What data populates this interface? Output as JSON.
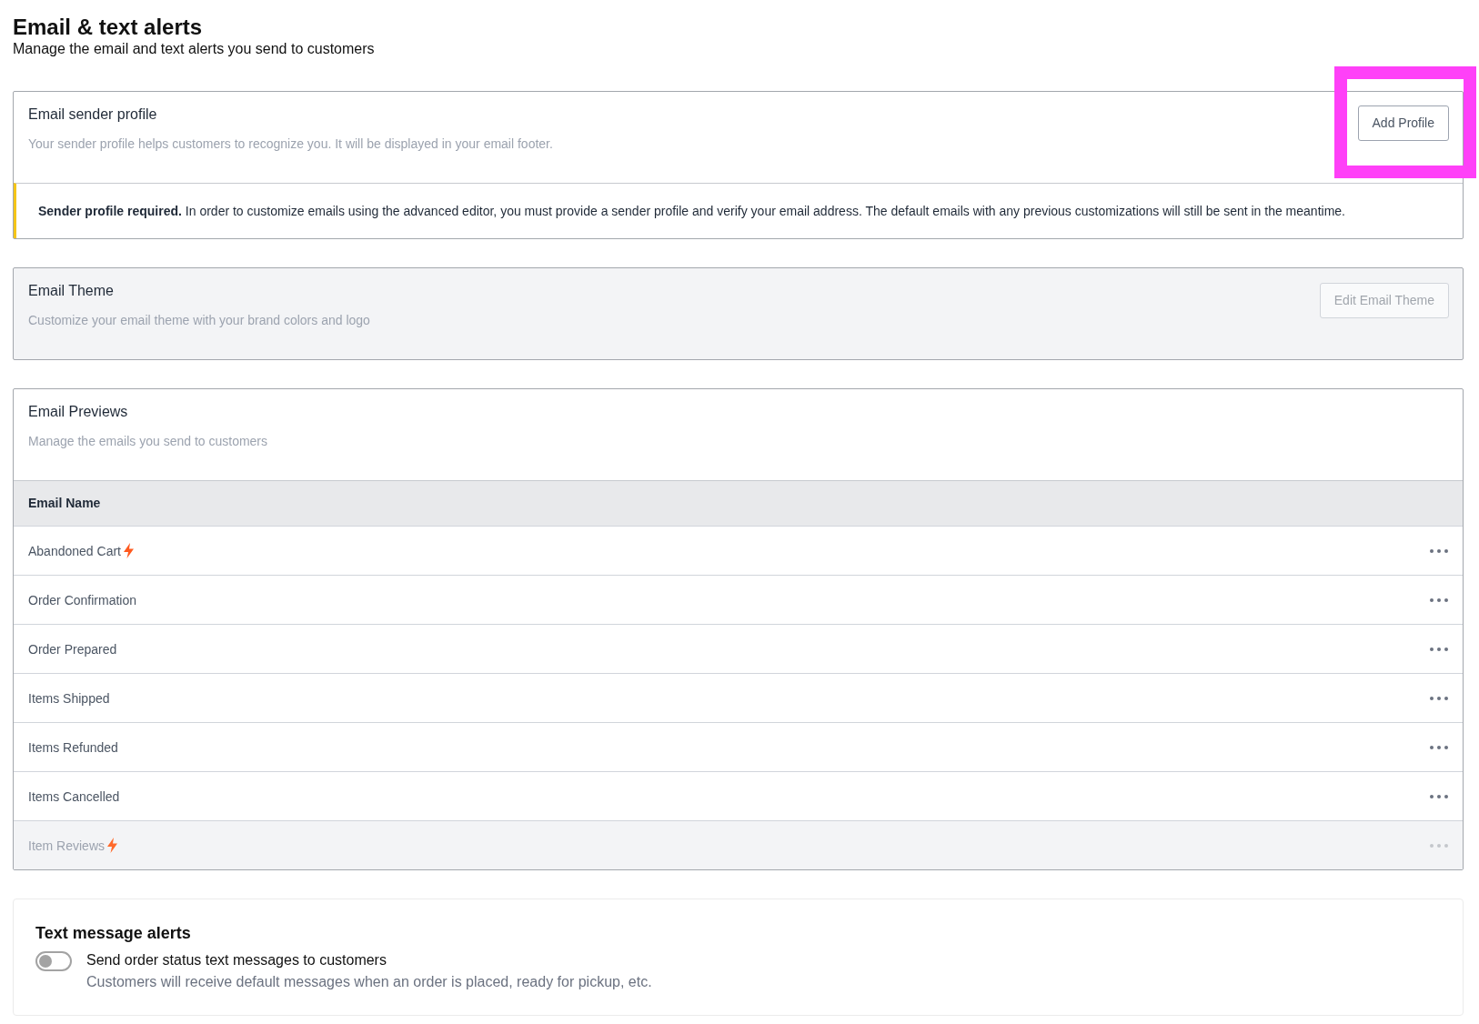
{
  "page": {
    "title": "Email & text alerts",
    "subtitle": "Manage the email and text alerts you send to customers"
  },
  "sender_profile": {
    "title": "Email sender profile",
    "description": "Your sender profile helps customers to recognize you. It will be displayed in your email footer.",
    "button": {
      "label": "Add Profile",
      "highlighted": true
    },
    "alert": {
      "text": "**Sender profile required.** In order to customize emails using the advanced editor, you must provide a sender profile and verify your email address. The default emails with any previous customizations will still be sent in the meantime."
    }
  },
  "email_theme": {
    "title": "Email Theme",
    "description": "Customize your email theme with your brand colors and logo",
    "disabled": true,
    "button": {
      "label": "Edit Email Theme"
    }
  },
  "email_previews": {
    "title": "Email Previews",
    "description": "Manage the emails you send to customers",
    "table": {
      "columns": [
        "Email Name"
      ],
      "rows": [
        {
          "name": "Abandoned Cart",
          "lightning": true,
          "disabled": false
        },
        {
          "name": "Order Confirmation",
          "lightning": false,
          "disabled": false
        },
        {
          "name": "Order Prepared",
          "lightning": false,
          "disabled": false
        },
        {
          "name": "Items Shipped",
          "lightning": false,
          "disabled": false
        },
        {
          "name": "Items Refunded",
          "lightning": false,
          "disabled": false
        },
        {
          "name": "Items Cancelled",
          "lightning": false,
          "disabled": false
        },
        {
          "name": "Item Reviews",
          "lightning": true,
          "disabled": true
        }
      ]
    }
  },
  "text_alerts": {
    "title": "Text message alerts",
    "toggle": {
      "label": "Send order status text messages to customers",
      "description": "Customers will receive default messages when an order is placed, ready for pickup, etc.",
      "on": false
    }
  }
}
